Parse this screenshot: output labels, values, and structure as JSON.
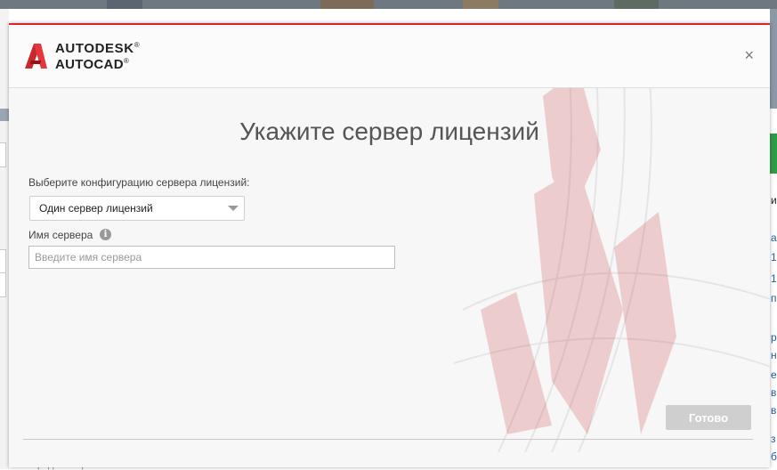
{
  "background": {
    "right_edge_letters": [
      "и",
      "а",
      "1",
      "1",
      "п",
      "р",
      "н",
      "е",
      "в",
      "в",
      "з",
      "б"
    ],
    "bottom_partial_text": "Порядок лицензии"
  },
  "dialog": {
    "accent_color": "#d9262c",
    "brand_line1": "AUTODESK",
    "brand_line2": "AUTOCAD",
    "registered_mark": "®",
    "logo_icon": "autocad-logo-icon",
    "close_icon": "close-icon",
    "close_symbol": "×",
    "title": "Укажите сервер лицензий",
    "config_label": "Выберите конфигурацию сервера лицензий:",
    "config_selected": "Один сервер лицензий",
    "server_name_label": "Имя сервера",
    "info_icon_symbol": "i",
    "server_name_placeholder": "Введите имя сервера",
    "server_name_value": "",
    "done_button": "Готово"
  }
}
